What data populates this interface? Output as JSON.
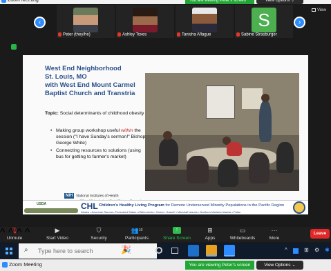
{
  "window": {
    "title": "Zoom Meeting",
    "share_banner": "You are viewing Peter's screen",
    "view_options": "View Options ⌄"
  },
  "gallery": {
    "participants": [
      {
        "name": "Peter (they/he)"
      },
      {
        "name": "Ashley Toxes"
      },
      {
        "name": "Tanisha Aflague"
      },
      {
        "name": "Sabine Strasburger",
        "initial": "S"
      }
    ],
    "view_label": "View"
  },
  "slide": {
    "title_lines": [
      "West End Neighborhood",
      "St. Louis, MO",
      "with West End Mount Carmel",
      "Baptist Church and Transtria"
    ],
    "topic_label": "Topic:",
    "topic_text": " Social determinants of childhood obesity",
    "bullets": [
      {
        "pre": "Making group workshop useful ",
        "em": "within",
        "post": " the session (\"I have Sunday's sermon!\" Bishop George White)"
      },
      {
        "pre": "Connecting resources to solutions (using bus for getting to farmer's market)",
        "em": "",
        "post": ""
      }
    ],
    "nih_badge": "NIH",
    "nih_line1": "National Institutes of Health",
    "nih_line2": "Office of Behavioral and Social Sciences Research",
    "usda": "USDA",
    "chl_logo": "CHL",
    "chl_title": "Children's Healthy Living Program",
    "chl_rest": " for Remote Underserved Minority Populations in the Pacific Region",
    "chl_sub": "Alaska • American Samoa • Federated States of Micronesia • Guam • Hawaiʻi • Marshall Islands • Northern Mariana Islands • Palau"
  },
  "toolbar": {
    "unmute": "Unmute",
    "start_video": "Start Video",
    "security": "Security",
    "participants": "Participants",
    "participants_count": "10",
    "share_screen": "Share Screen",
    "apps": "Apps",
    "whiteboards": "Whiteboards",
    "more": "More",
    "leave": "Leave"
  },
  "taskbar": {
    "search_placeholder": "Type here to search"
  },
  "colors": {
    "zoom_blue": "#2d8cff",
    "share_green": "#23a636",
    "leave_red": "#e02828",
    "slide_title_blue": "#2a4f8a"
  }
}
